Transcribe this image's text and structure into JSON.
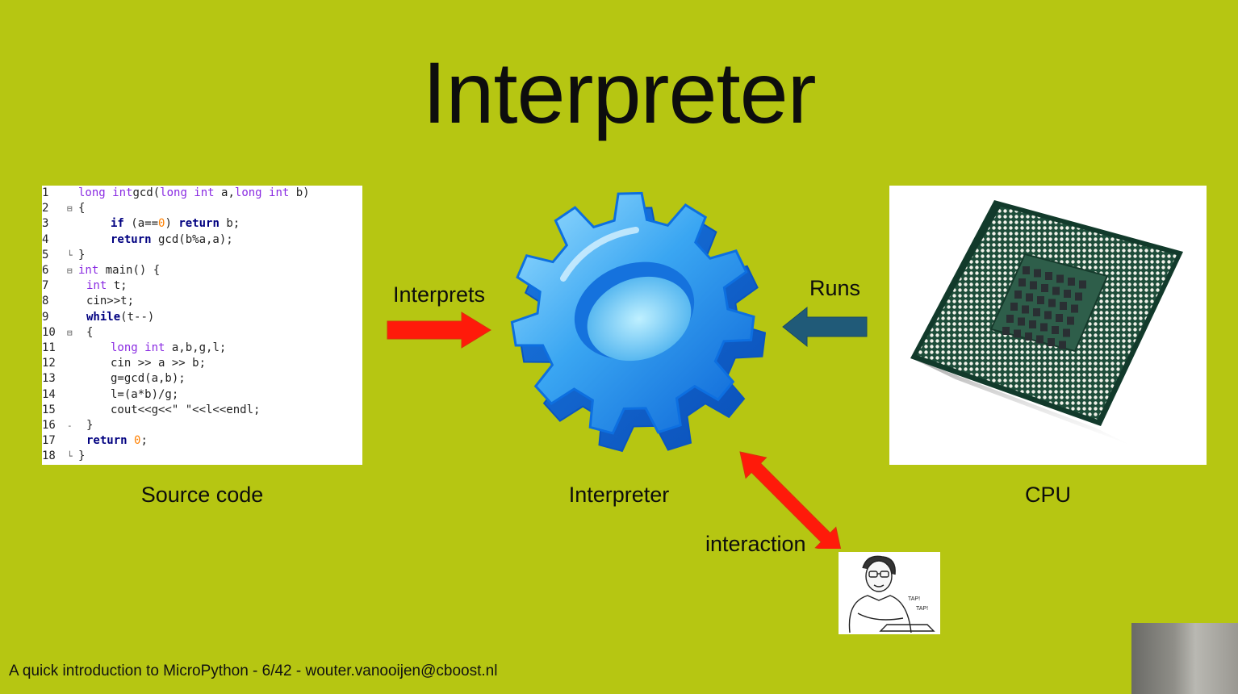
{
  "title": "Interpreter",
  "source_code": {
    "caption": "Source code",
    "lines": [
      {
        "n": "1",
        "fold": "",
        "indent": 0,
        "tokens": [
          [
            "ty",
            "long int"
          ],
          [
            "",
            "gcd("
          ],
          [
            "ty",
            "long int"
          ],
          [
            "",
            " a,"
          ],
          [
            "ty",
            "long int"
          ],
          [
            "",
            " b)"
          ]
        ]
      },
      {
        "n": "2",
        "fold": "⊟",
        "indent": 0,
        "tokens": [
          [
            "",
            "{"
          ]
        ]
      },
      {
        "n": "3",
        "fold": "",
        "indent": 2,
        "tokens": [
          [
            "kw",
            "if"
          ],
          [
            "",
            " (a=="
          ],
          [
            "num",
            "0"
          ],
          [
            "",
            ") "
          ],
          [
            "kw",
            "return"
          ],
          [
            "",
            " b;"
          ]
        ]
      },
      {
        "n": "4",
        "fold": "",
        "indent": 2,
        "tokens": [
          [
            "kw",
            "return"
          ],
          [
            "",
            " gcd(b%a,a);"
          ]
        ]
      },
      {
        "n": "5",
        "fold": "└",
        "indent": 0,
        "tokens": [
          [
            "",
            "}"
          ]
        ]
      },
      {
        "n": "6",
        "fold": "⊟",
        "indent": 0,
        "tokens": [
          [
            "ty",
            "int"
          ],
          [
            "",
            " main() {"
          ]
        ]
      },
      {
        "n": "7",
        "fold": "",
        "indent": 1,
        "tokens": [
          [
            "ty",
            "int"
          ],
          [
            "",
            " t;"
          ]
        ]
      },
      {
        "n": "8",
        "fold": "",
        "indent": 1,
        "tokens": [
          [
            "",
            "cin>>t;"
          ]
        ]
      },
      {
        "n": "9",
        "fold": "",
        "indent": 1,
        "tokens": [
          [
            "kw",
            "while"
          ],
          [
            "",
            "(t--)"
          ]
        ]
      },
      {
        "n": "10",
        "fold": "⊟",
        "indent": 1,
        "tokens": [
          [
            "",
            "{"
          ]
        ]
      },
      {
        "n": "11",
        "fold": "",
        "indent": 2,
        "tokens": [
          [
            "ty",
            "long int"
          ],
          [
            "",
            " a,b,g,l;"
          ]
        ]
      },
      {
        "n": "12",
        "fold": "",
        "indent": 2,
        "tokens": [
          [
            "",
            "cin >> a >> b;"
          ]
        ]
      },
      {
        "n": "13",
        "fold": "",
        "indent": 2,
        "tokens": [
          [
            "",
            "g=gcd(a,b);"
          ]
        ]
      },
      {
        "n": "14",
        "fold": "",
        "indent": 2,
        "tokens": [
          [
            "",
            "l=(a*b)/g;"
          ]
        ]
      },
      {
        "n": "15",
        "fold": "",
        "indent": 2,
        "tokens": [
          [
            "",
            "cout<<g<<\" \"<<l<<endl;"
          ]
        ]
      },
      {
        "n": "16",
        "fold": "-",
        "indent": 1,
        "tokens": [
          [
            "",
            "}"
          ]
        ]
      },
      {
        "n": "17",
        "fold": "",
        "indent": 1,
        "tokens": [
          [
            "kw",
            "return"
          ],
          [
            "num",
            " 0"
          ],
          [
            "",
            ";"
          ]
        ]
      },
      {
        "n": "18",
        "fold": "└",
        "indent": 0,
        "tokens": [
          [
            "",
            "}"
          ]
        ]
      }
    ]
  },
  "interpreter_caption": "Interpreter",
  "cpu_caption": "CPU",
  "arrows": {
    "interprets": "Interprets",
    "runs": "Runs",
    "interaction": "interaction"
  },
  "person_image": {
    "icon": "person-typing-icon",
    "tap_text_1": "TAP!",
    "tap_text_2": "TAP!"
  },
  "footer": "A quick introduction to MicroPython - 6/42 - wouter.vanooijen@cboost.nl",
  "colors": {
    "background": "#b6c612",
    "arrow_red": "#ff1a0a",
    "arrow_blue": "#205a78",
    "gear_blue": "#38a8f0"
  }
}
